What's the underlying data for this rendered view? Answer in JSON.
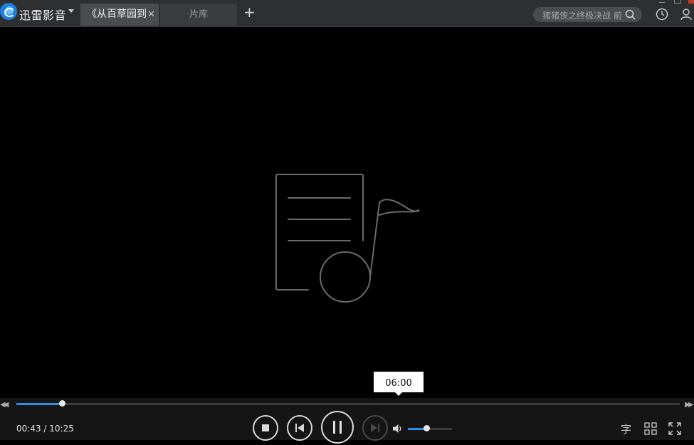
{
  "app": {
    "name": "迅雷影音"
  },
  "tabs": [
    {
      "label": "《从百草园到",
      "active": true
    },
    {
      "label": "片库",
      "active": false
    }
  ],
  "search": {
    "placeholder": "猪猪侠之终极决战 前"
  },
  "player": {
    "current_time": "00:43",
    "time_separator": " / ",
    "duration": "10:25",
    "progress_fraction": 0.069,
    "hover_time": "06:00",
    "volume_fraction": 0.42,
    "subtitle_label": "字"
  },
  "colors": {
    "accent": "#2e8be8",
    "titlebar": "#2e2f31",
    "controlbar": "#151516"
  },
  "icons": [
    "app-logo-icon",
    "search-icon",
    "history-clock-icon",
    "user-icon",
    "music-file-placeholder-icon",
    "stop-icon",
    "previous-icon",
    "pause-icon",
    "next-icon",
    "volume-icon",
    "playlist-grid-icon",
    "fullscreen-icon"
  ]
}
